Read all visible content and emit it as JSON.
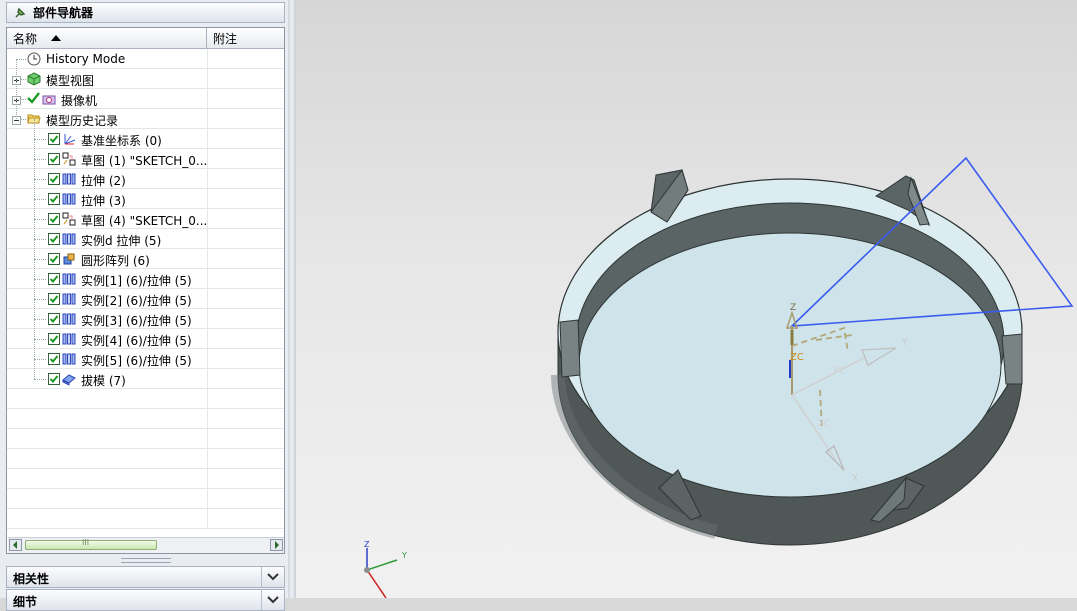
{
  "navigator": {
    "title": "部件导航器",
    "columns": {
      "name": "名称",
      "note": "附注"
    },
    "items": [
      {
        "label": "History Mode",
        "icon": "clock-icon",
        "level": 0,
        "expander": "none",
        "check": false
      },
      {
        "label": "模型视图",
        "icon": "model-view-icon",
        "level": 0,
        "expander": "plus",
        "check": false
      },
      {
        "label": "摄像机",
        "icon": "camera-icon",
        "level": 0,
        "expander": "plus",
        "check": true
      },
      {
        "label": "模型历史记录",
        "icon": "folder-open-icon",
        "level": 0,
        "expander": "minus",
        "check": false
      },
      {
        "label": "基准坐标系 (0)",
        "icon": "datum-csys-icon",
        "level": 1,
        "check": true
      },
      {
        "label": "草图 (1) \"SKETCH_0...",
        "icon": "sketch-icon",
        "level": 1,
        "check": true
      },
      {
        "label": "拉伸 (2)",
        "icon": "extrude-icon",
        "level": 1,
        "check": true
      },
      {
        "label": "拉伸 (3)",
        "icon": "extrude-icon",
        "level": 1,
        "check": true
      },
      {
        "label": "草图 (4) \"SKETCH_0...",
        "icon": "sketch-icon",
        "level": 1,
        "check": true
      },
      {
        "label": "实例d 拉伸 (5)",
        "icon": "extrude-icon",
        "level": 1,
        "check": true
      },
      {
        "label": "圆形阵列 (6)",
        "icon": "circular-array-icon",
        "level": 1,
        "check": true
      },
      {
        "label": "实例[1] (6)/拉伸 (5)",
        "icon": "extrude-icon",
        "level": 1,
        "check": true
      },
      {
        "label": "实例[2] (6)/拉伸 (5)",
        "icon": "extrude-icon",
        "level": 1,
        "check": true
      },
      {
        "label": "实例[3] (6)/拉伸 (5)",
        "icon": "extrude-icon",
        "level": 1,
        "check": true
      },
      {
        "label": "实例[4] (6)/拉伸 (5)",
        "icon": "extrude-icon",
        "level": 1,
        "check": true
      },
      {
        "label": "实例[5] (6)/拉伸 (5)",
        "icon": "extrude-icon",
        "level": 1,
        "check": true
      },
      {
        "label": "拔模 (7)",
        "icon": "draft-icon",
        "level": 1,
        "check": true
      }
    ],
    "scrollbar_grip": "III"
  },
  "panels": {
    "dependencies": "相关性",
    "details": "细节"
  },
  "viewport": {
    "csys_labels": {
      "z": "Z",
      "y": "Y",
      "x": "X",
      "zc": "ZC",
      "xc": "XC",
      "yc": "YC"
    },
    "triad_labels": {
      "z": "Z",
      "y": "Y"
    },
    "colors": {
      "plane_edge": "#3a5cf0",
      "body_dark": "#4d5555",
      "floor": "#cfe4ea",
      "rim": "#d9ecf1",
      "csys_tan": "#a79a6c",
      "check_green": "#1d9a26"
    }
  }
}
